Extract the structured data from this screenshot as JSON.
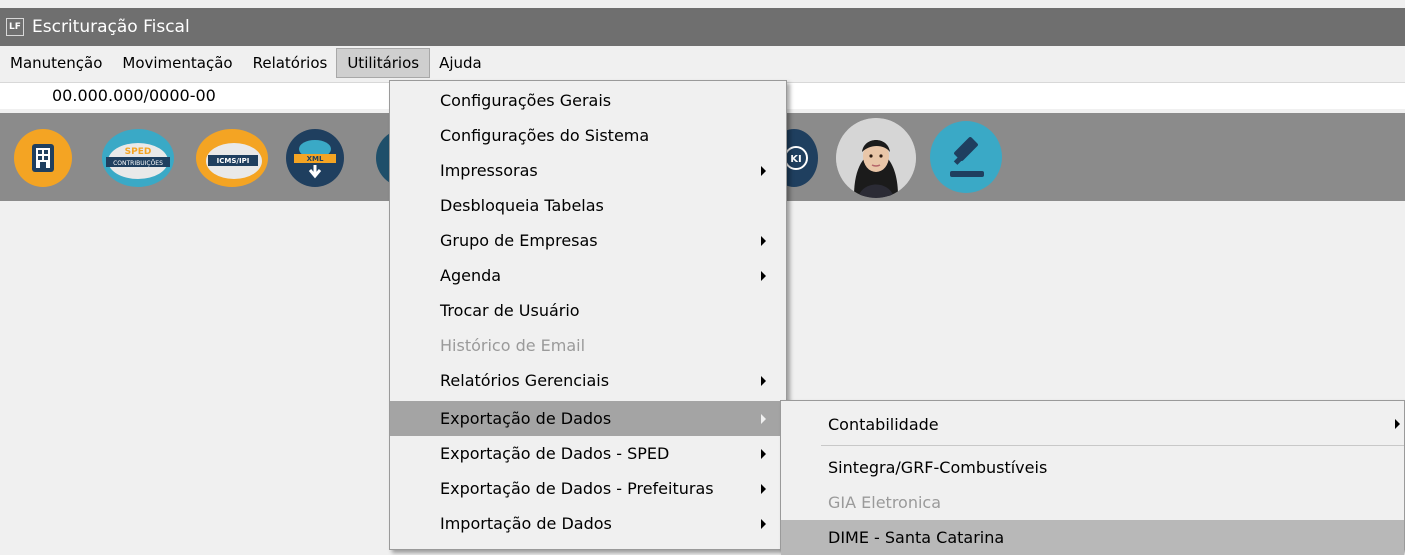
{
  "window": {
    "title": "Escrituração Fiscal",
    "icon_label": "LF"
  },
  "menubar": [
    {
      "label": "Manutenção"
    },
    {
      "label": "Movimentação"
    },
    {
      "label": "Relatórios"
    },
    {
      "label": "Utilitários"
    },
    {
      "label": "Ajuda"
    }
  ],
  "document": {
    "cnpj": "00.000.000/0000-00"
  },
  "toolbar": {
    "buttons": [
      {
        "name": "company-icon",
        "label": ""
      },
      {
        "name": "sped-contribuicoes-icon",
        "top": "SPED",
        "label": "CONTRIBUIÇÕES"
      },
      {
        "name": "icms-ipi-icon",
        "label": "ICMS/IPI"
      },
      {
        "name": "xml-download-icon",
        "label": "XML"
      },
      {
        "name": "wiki-icon",
        "label": "KI"
      },
      {
        "name": "assistant-avatar-icon",
        "label": ""
      },
      {
        "name": "gavel-icon",
        "label": ""
      }
    ]
  },
  "utilitarios_menu": {
    "items": [
      {
        "label": "Configurações Gerais",
        "submenu": false,
        "disabled": false
      },
      {
        "label": "Configurações do Sistema",
        "submenu": false,
        "disabled": false
      },
      {
        "label": "Impressoras",
        "submenu": true,
        "disabled": false
      },
      {
        "label": "Desbloqueia Tabelas",
        "submenu": false,
        "disabled": false
      },
      {
        "label": "Grupo de Empresas",
        "submenu": true,
        "disabled": false
      },
      {
        "label": "Agenda",
        "submenu": true,
        "disabled": false
      },
      {
        "label": "Trocar de Usuário",
        "submenu": false,
        "disabled": false
      },
      {
        "label": "Histórico de Email",
        "submenu": false,
        "disabled": true
      },
      {
        "label": "Relatórios Gerenciais",
        "submenu": true,
        "disabled": false
      },
      {
        "label": "Exportação de Dados",
        "submenu": true,
        "disabled": false,
        "highlighted": true
      },
      {
        "label": "Exportação de Dados - SPED",
        "submenu": true,
        "disabled": false
      },
      {
        "label": "Exportação de Dados - Prefeituras",
        "submenu": true,
        "disabled": false
      },
      {
        "label": "Importação de Dados",
        "submenu": true,
        "disabled": false
      }
    ]
  },
  "exportacao_submenu": {
    "items": [
      {
        "label": "Contabilidade",
        "submenu": true,
        "disabled": false
      },
      {
        "label": "Sintegra/GRF-Combustíveis",
        "submenu": false,
        "disabled": false
      },
      {
        "label": "GIA Eletronica",
        "submenu": false,
        "disabled": true
      },
      {
        "label": "DIME - Santa Catarina",
        "submenu": false,
        "disabled": false,
        "highlighted": true
      }
    ]
  },
  "colors": {
    "titlebar": "#6f6f6f",
    "toolbar": "#8b8b8b",
    "menu_highlight": "#a4a4a4",
    "orange": "#f4a423",
    "teal": "#3aa9c6",
    "navy": "#1f3f5f"
  }
}
